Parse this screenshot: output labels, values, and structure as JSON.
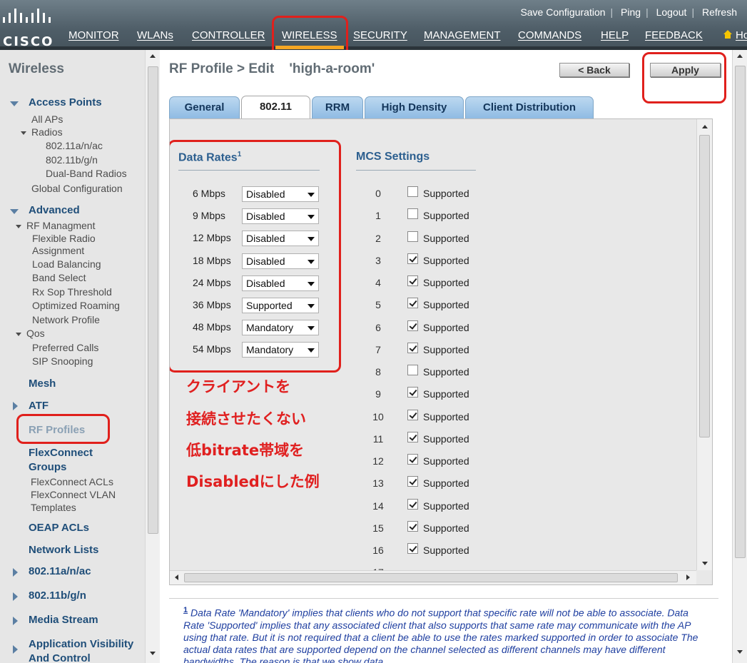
{
  "header": {
    "brand": "CISCO",
    "top_links": [
      "Save Configuration",
      "Ping",
      "Logout",
      "Refresh"
    ],
    "nav": [
      "MONITOR",
      "WLANs",
      "CONTROLLER",
      "WIRELESS",
      "SECURITY",
      "MANAGEMENT",
      "COMMANDS",
      "HELP",
      "FEEDBACK",
      "Ho"
    ],
    "active_nav": "WIRELESS"
  },
  "sidebar": {
    "title": "Wireless",
    "access_points": "Access Points",
    "all_aps": "All APs",
    "radios": "Radios",
    "radio_items": [
      "802.11a/n/ac",
      "802.11b/g/n",
      "Dual-Band Radios"
    ],
    "global_config": "Global Configuration",
    "advanced": "Advanced",
    "rf_management": "RF Managment",
    "rf_items": [
      "Flexible Radio",
      "Assignment",
      "Load Balancing",
      "Band Select",
      "Rx Sop Threshold",
      "Optimized Roaming",
      "Network Profile"
    ],
    "qos": "Qos",
    "qos_items": [
      "Preferred Calls",
      "SIP Snooping"
    ],
    "sections": [
      "Mesh",
      "ATF",
      "RF Profiles",
      "FlexConnect",
      "Groups"
    ],
    "flex_items": [
      "FlexConnect ACLs",
      "FlexConnect VLAN",
      "Templates"
    ],
    "bottom_sections": [
      "OEAP ACLs",
      "Network Lists",
      "802.11a/n/ac",
      "802.11b/g/n",
      "Media Stream",
      "Application Visibility",
      "And Control"
    ]
  },
  "page": {
    "title": "RF Profile > Edit",
    "profile_name": "'high-a-room'",
    "back_label": "< Back",
    "apply_label": "Apply"
  },
  "tabs": [
    "General",
    "802.11",
    "RRM",
    "High Density",
    "Client Distribution"
  ],
  "data_rates": {
    "heading": "Data Rates",
    "footnote_ref": "1",
    "rows": [
      {
        "rate": "6 Mbps",
        "value": "Disabled"
      },
      {
        "rate": "9 Mbps",
        "value": "Disabled"
      },
      {
        "rate": "12 Mbps",
        "value": "Disabled"
      },
      {
        "rate": "18 Mbps",
        "value": "Disabled"
      },
      {
        "rate": "24 Mbps",
        "value": "Disabled"
      },
      {
        "rate": "36 Mbps",
        "value": "Supported"
      },
      {
        "rate": "48 Mbps",
        "value": "Mandatory"
      },
      {
        "rate": "54 Mbps",
        "value": "Mandatory"
      }
    ]
  },
  "mcs": {
    "heading": "MCS Settings",
    "label": "Supported",
    "rows": [
      {
        "n": "0",
        "checked": false
      },
      {
        "n": "1",
        "checked": false
      },
      {
        "n": "2",
        "checked": false
      },
      {
        "n": "3",
        "checked": true
      },
      {
        "n": "4",
        "checked": true
      },
      {
        "n": "5",
        "checked": true
      },
      {
        "n": "6",
        "checked": true
      },
      {
        "n": "7",
        "checked": true
      },
      {
        "n": "8",
        "checked": false
      },
      {
        "n": "9",
        "checked": true
      },
      {
        "n": "10",
        "checked": true
      },
      {
        "n": "11",
        "checked": true
      },
      {
        "n": "12",
        "checked": true
      },
      {
        "n": "13",
        "checked": true
      },
      {
        "n": "14",
        "checked": true
      },
      {
        "n": "15",
        "checked": true
      },
      {
        "n": "16",
        "checked": true
      }
    ]
  },
  "annotation": [
    "クライアントを",
    "接続させたくない",
    "低bitrate帯域を",
    "Disabledにした例"
  ],
  "footnote": {
    "marker": "1",
    "text": "Data Rate 'Mandatory' implies that clients who do not support that specific rate will not be able to associate. Data Rate 'Supported' implies that any associated client that also supports that same rate may communicate with the AP using that rate. But it is not required that a client be able to use the rates marked supported in order to associate The actual data rates that are supported depend on the channel selected as different channels may have different bandwidths. The reason is that we show data"
  },
  "colors": {
    "accent": "#f5a623",
    "annotation_red": "#e0201c",
    "header": "#5a6973",
    "link_blue": "#1f4e79"
  }
}
